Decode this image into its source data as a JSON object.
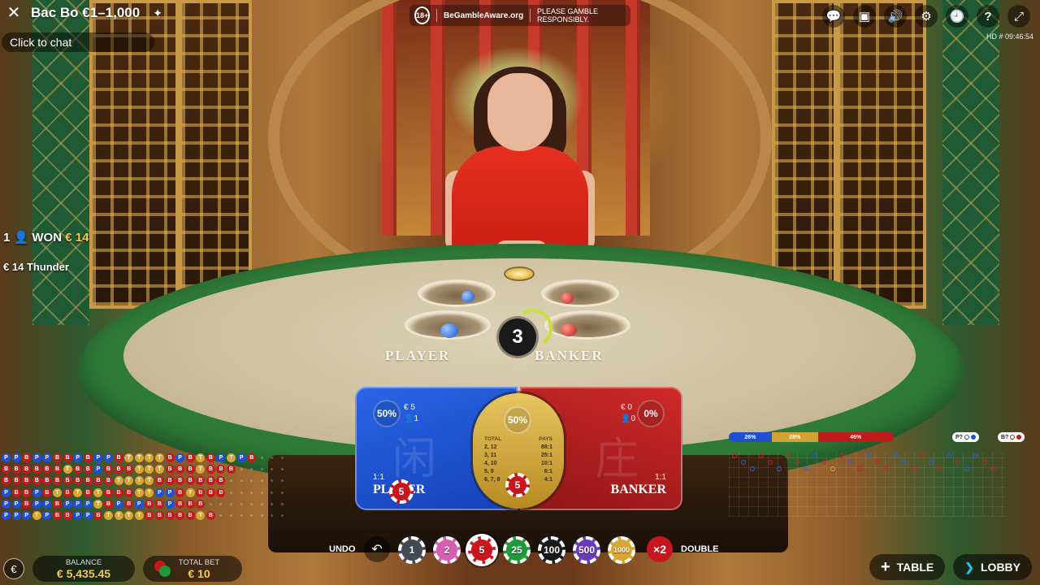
{
  "header": {
    "title": "Bac Bo €1–1,000",
    "chat_placeholder": "Click to chat",
    "responsible": {
      "age": "18+",
      "begamble": "BeGambleAware.org",
      "note": "PLEASE GAMBLE RESPONSIBLY."
    },
    "right_icons": [
      "chat-bubbles-icon",
      "video-camera-icon",
      "volume-icon",
      "settings-gear-icon",
      "history-clock-icon",
      "help-icon",
      "fullscreen-icon"
    ],
    "hd_clock": "HD  # 09:46:54"
  },
  "left_info": {
    "won_count": "1",
    "won_label": "WON",
    "won_amount": "€ 14",
    "thunder": "€ 14 Thunder"
  },
  "table": {
    "player_label": "PLAYER",
    "banker_label": "BANKER",
    "countdown": "3"
  },
  "bets": {
    "player": {
      "pct": "50%",
      "amount": "€ 5",
      "players": "1",
      "odds": "1:1",
      "name": "PLAYER",
      "chip": "5",
      "glyph": "闲"
    },
    "tie": {
      "pct": "50%",
      "head_total": "TOTAL",
      "head_pays": "PAYS",
      "rows": [
        {
          "total": "2, 12",
          "pays": "88:1"
        },
        {
          "total": "3, 11",
          "pays": "25:1"
        },
        {
          "total": "4, 10",
          "pays": "10:1"
        },
        {
          "total": "5, 9",
          "pays": "6:1"
        },
        {
          "total": "6, 7, 8",
          "pays": "4:1"
        }
      ],
      "chip": "5"
    },
    "banker": {
      "pct": "0%",
      "amount": "€ 0",
      "players": "0",
      "odds": "1:1",
      "name": "BANKER",
      "glyph": "庄"
    }
  },
  "stats": {
    "player_pct": "26%",
    "tie_pct": "28%",
    "banker_pct": "46%",
    "predict_p": "P?",
    "predict_b": "B?"
  },
  "bead_road": [
    "PPBPPBBPBPPBTTTTBPBTBPTPB",
    "BBBBBBTBBPBBBTTTBBBTBBB",
    "BBBBBBBBBBBTTTTBBBBBBB",
    "PBBPBTBTBTBBBTTPPBTBBB",
    "PPBPPBPPPTBPBPBBPBBB",
    "PPPTPBBPPBTTTTBBBBBTB"
  ],
  "bottom": {
    "currency_icon": "€",
    "balance_label": "BALANCE",
    "balance_value": "€ 5,435.45",
    "total_bet_label": "TOTAL BET",
    "total_bet_value": "€ 10",
    "undo": "UNDO",
    "chips": [
      {
        "value": "1",
        "color": "#444a52"
      },
      {
        "value": "2",
        "color": "#d45fb0"
      },
      {
        "value": "5",
        "color": "#c8161e"
      },
      {
        "value": "25",
        "color": "#1f9a3a"
      },
      {
        "value": "100",
        "color": "#1a1a1a"
      },
      {
        "value": "500",
        "color": "#6b3ab8"
      },
      {
        "value": "1000",
        "color": "#d8a632"
      }
    ],
    "selected_chip": "5",
    "double_symbol": "×2",
    "double_label": "DOUBLE",
    "table_label": "TABLE",
    "lobby_label": "LOBBY"
  }
}
